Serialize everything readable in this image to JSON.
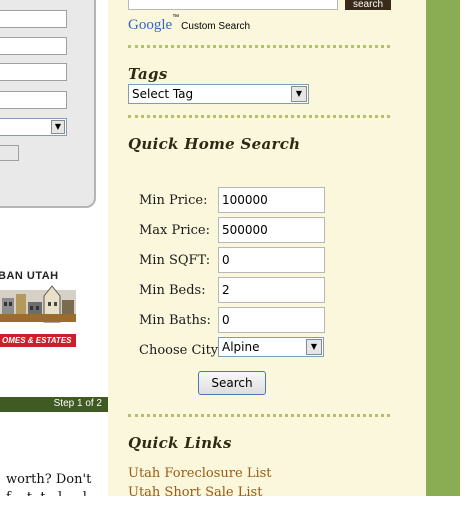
{
  "left": {
    "logo_text": "BAN UTAH",
    "logo_banner": "OMES & ESTATES",
    "step_label": "Step 1 of 2",
    "text_line1": "worth? Don't",
    "text_line2": "f... t .t ..l ... l .."
  },
  "top_search": {
    "button_label": "search",
    "google_logo": "Google",
    "trademark": "™",
    "custom_search": "Custom Search"
  },
  "tags": {
    "heading": "Tags",
    "selected": "Select Tag"
  },
  "quick_search": {
    "heading": "Quick Home Search",
    "fields": [
      {
        "label": "Min Price:",
        "value": "100000"
      },
      {
        "label": "Max Price:",
        "value": "500000"
      },
      {
        "label": "Min SQFT:",
        "value": "0"
      },
      {
        "label": "Min Beds:",
        "value": "2"
      },
      {
        "label": "Min Baths:",
        "value": "0"
      }
    ],
    "city_label": "Choose City",
    "city_selected": "Alpine",
    "button_label": "Search"
  },
  "quick_links": {
    "heading": "Quick Links",
    "items": [
      "Utah Foreclosure List",
      "Utah Short Sale List"
    ]
  },
  "colors": {
    "sidebar_bg": "#fbf7dc",
    "accent_green": "#8aac52",
    "link": "#9a5b12"
  }
}
